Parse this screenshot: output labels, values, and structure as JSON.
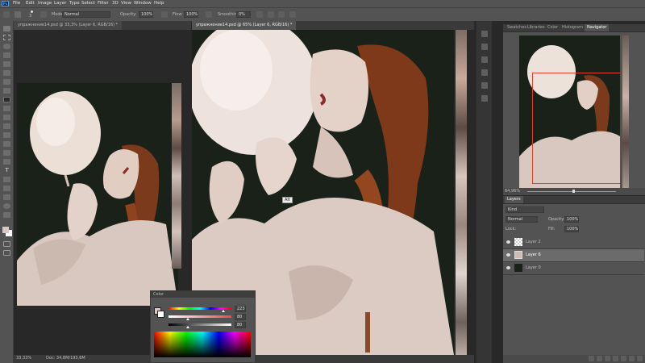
{
  "app": {
    "logo": "Ps"
  },
  "menu": [
    "File",
    "Edit",
    "Image",
    "Layer",
    "Type",
    "Select",
    "Filter",
    "3D",
    "View",
    "Window",
    "Help"
  ],
  "options": {
    "mode_label": "Mode:",
    "mode_value": "Normal",
    "opacity_label": "Opacity:",
    "opacity_value": "100%",
    "flow_label": "Flow:",
    "flow_value": "100%",
    "smoothing_label": "Smoothing:",
    "smoothing_value": "0%",
    "brush_size": "3"
  },
  "documents": [
    {
      "tab": "упражнение14.psd @ 33,3% (Layer 6, RGB/16) *"
    },
    {
      "tab": "упражнение14.psd @ 65% (Layer 6, RGB/16) *"
    }
  ],
  "cursor_tooltip": "Alt",
  "status": {
    "zoom": "33,33%",
    "doc": "Doc: 34,8M/193,6M"
  },
  "navigator": {
    "tabs": [
      "Swatches",
      "Libraries",
      "Color",
      "Histogram",
      "Navigator"
    ],
    "active_tab": "Navigator",
    "zoom": "64,96%",
    "view_frame_color": "#e0412f"
  },
  "layers_panel": {
    "tabs": [
      "Layers"
    ],
    "filter_label": "Kind",
    "blend_mode": "Normal",
    "opacity_label": "Opacity:",
    "opacity_value": "100%",
    "lock_label": "Lock:",
    "fill_label": "Fill:",
    "fill_value": "100%",
    "layers": [
      {
        "name": "Layer 2",
        "selected": false
      },
      {
        "name": "Layer 6",
        "selected": true
      },
      {
        "name": "Layer 0",
        "selected": false
      }
    ]
  },
  "color_panel": {
    "title": "Color",
    "sliders": [
      {
        "value": "223",
        "level": 0.87
      },
      {
        "value": "80",
        "level": 0.31
      },
      {
        "value": "80",
        "level": 0.31
      }
    ],
    "foreground": "#d7c8c3",
    "background": "#ffffff"
  },
  "colors": {
    "accent": "#31a8ff",
    "ui_dark": "#282828",
    "ui_mid": "#535353",
    "art_bg": "#1a2119"
  }
}
